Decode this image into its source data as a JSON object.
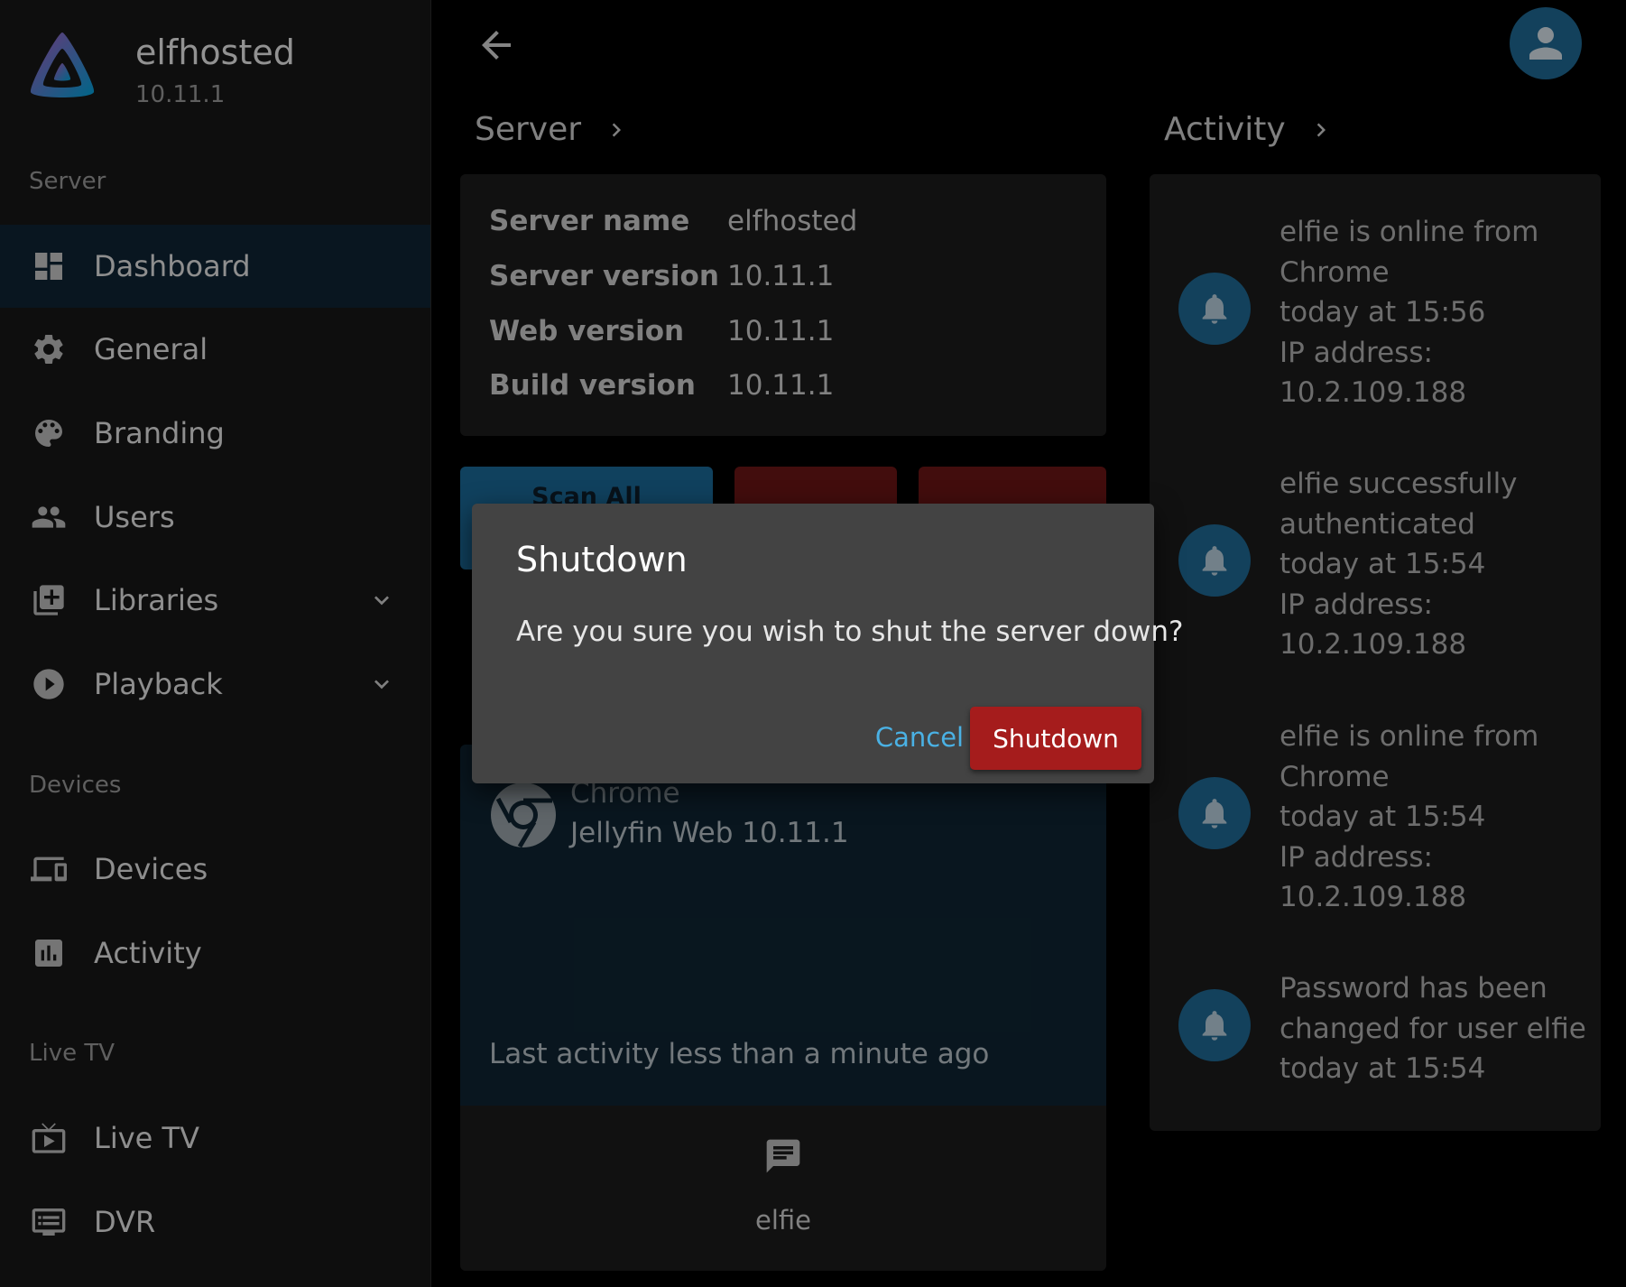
{
  "brand": {
    "name": "elfhosted",
    "version": "10.11.1"
  },
  "sidebar": {
    "sections": [
      {
        "title": "Server"
      },
      {
        "title": "Devices"
      },
      {
        "title": "Live TV"
      }
    ],
    "items": [
      {
        "label": "Dashboard",
        "icon": "dashboard-icon",
        "active": true
      },
      {
        "label": "General",
        "icon": "gear-icon"
      },
      {
        "label": "Branding",
        "icon": "palette-icon"
      },
      {
        "label": "Users",
        "icon": "users-icon"
      },
      {
        "label": "Libraries",
        "icon": "library-add-icon",
        "expandable": true
      },
      {
        "label": "Playback",
        "icon": "play-circle-icon",
        "expandable": true
      },
      {
        "label": "Devices",
        "icon": "devices-icon"
      },
      {
        "label": "Activity",
        "icon": "chart-icon"
      },
      {
        "label": "Live TV",
        "icon": "tv-icon"
      },
      {
        "label": "DVR",
        "icon": "dvr-icon"
      }
    ]
  },
  "header": {
    "server_title": "Server",
    "activity_title": "Activity"
  },
  "server_info": [
    {
      "key": "Server name",
      "value": "elfhosted"
    },
    {
      "key": "Server version",
      "value": "10.11.1"
    },
    {
      "key": "Web version",
      "value": "10.11.1"
    },
    {
      "key": "Build version",
      "value": "10.11.1"
    }
  ],
  "actions": {
    "scan_all": "Scan All"
  },
  "session": {
    "app": "Chrome",
    "client": "Jellyfin Web 10.11.1",
    "last_activity": "Last activity less than a minute ago",
    "user": "elfie"
  },
  "activity": [
    {
      "lines": [
        "elfie is online from",
        "Chrome",
        "today at 15:56",
        "IP address:",
        "10.2.109.188"
      ]
    },
    {
      "lines": [
        "elfie successfully",
        "authenticated",
        "today at 15:54",
        "IP address:",
        "10.2.109.188"
      ]
    },
    {
      "lines": [
        "elfie is online from",
        "Chrome",
        "today at 15:54",
        "IP address:",
        "10.2.109.188"
      ]
    },
    {
      "lines": [
        "Password has been",
        "changed for user elfie",
        "today at 15:54"
      ]
    }
  ],
  "dialog": {
    "title": "Shutdown",
    "message": "Are you sure you wish to shut the server down?",
    "cancel": "Cancel",
    "confirm": "Shutdown"
  },
  "colors": {
    "accent": "#1f6a95",
    "danger": "#a51c1c",
    "link": "#4ab1e4"
  }
}
